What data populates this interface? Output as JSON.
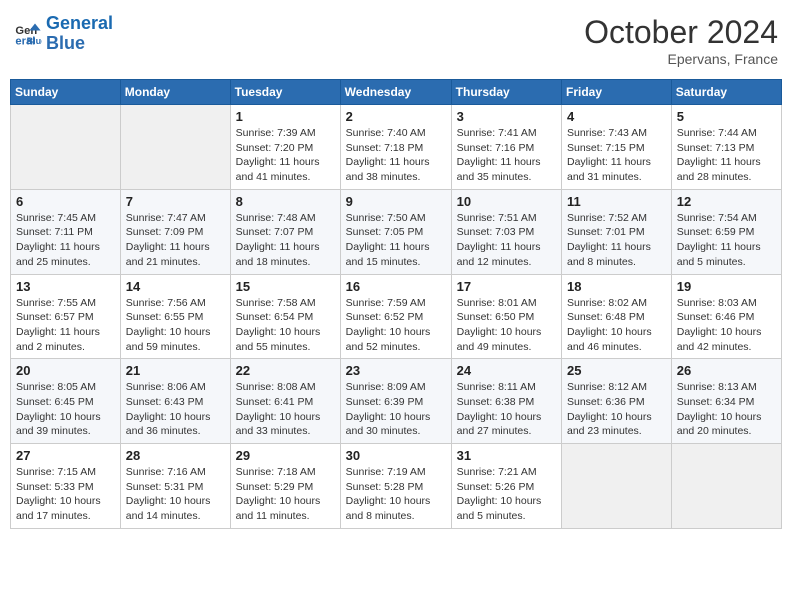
{
  "header": {
    "logo_line1": "General",
    "logo_line2": "Blue",
    "month_title": "October 2024",
    "location": "Epervans, France"
  },
  "weekdays": [
    "Sunday",
    "Monday",
    "Tuesday",
    "Wednesday",
    "Thursday",
    "Friday",
    "Saturday"
  ],
  "weeks": [
    [
      {
        "day": "",
        "info": ""
      },
      {
        "day": "",
        "info": ""
      },
      {
        "day": "1",
        "info": "Sunrise: 7:39 AM\nSunset: 7:20 PM\nDaylight: 11 hours and 41 minutes."
      },
      {
        "day": "2",
        "info": "Sunrise: 7:40 AM\nSunset: 7:18 PM\nDaylight: 11 hours and 38 minutes."
      },
      {
        "day": "3",
        "info": "Sunrise: 7:41 AM\nSunset: 7:16 PM\nDaylight: 11 hours and 35 minutes."
      },
      {
        "day": "4",
        "info": "Sunrise: 7:43 AM\nSunset: 7:15 PM\nDaylight: 11 hours and 31 minutes."
      },
      {
        "day": "5",
        "info": "Sunrise: 7:44 AM\nSunset: 7:13 PM\nDaylight: 11 hours and 28 minutes."
      }
    ],
    [
      {
        "day": "6",
        "info": "Sunrise: 7:45 AM\nSunset: 7:11 PM\nDaylight: 11 hours and 25 minutes."
      },
      {
        "day": "7",
        "info": "Sunrise: 7:47 AM\nSunset: 7:09 PM\nDaylight: 11 hours and 21 minutes."
      },
      {
        "day": "8",
        "info": "Sunrise: 7:48 AM\nSunset: 7:07 PM\nDaylight: 11 hours and 18 minutes."
      },
      {
        "day": "9",
        "info": "Sunrise: 7:50 AM\nSunset: 7:05 PM\nDaylight: 11 hours and 15 minutes."
      },
      {
        "day": "10",
        "info": "Sunrise: 7:51 AM\nSunset: 7:03 PM\nDaylight: 11 hours and 12 minutes."
      },
      {
        "day": "11",
        "info": "Sunrise: 7:52 AM\nSunset: 7:01 PM\nDaylight: 11 hours and 8 minutes."
      },
      {
        "day": "12",
        "info": "Sunrise: 7:54 AM\nSunset: 6:59 PM\nDaylight: 11 hours and 5 minutes."
      }
    ],
    [
      {
        "day": "13",
        "info": "Sunrise: 7:55 AM\nSunset: 6:57 PM\nDaylight: 11 hours and 2 minutes."
      },
      {
        "day": "14",
        "info": "Sunrise: 7:56 AM\nSunset: 6:55 PM\nDaylight: 10 hours and 59 minutes."
      },
      {
        "day": "15",
        "info": "Sunrise: 7:58 AM\nSunset: 6:54 PM\nDaylight: 10 hours and 55 minutes."
      },
      {
        "day": "16",
        "info": "Sunrise: 7:59 AM\nSunset: 6:52 PM\nDaylight: 10 hours and 52 minutes."
      },
      {
        "day": "17",
        "info": "Sunrise: 8:01 AM\nSunset: 6:50 PM\nDaylight: 10 hours and 49 minutes."
      },
      {
        "day": "18",
        "info": "Sunrise: 8:02 AM\nSunset: 6:48 PM\nDaylight: 10 hours and 46 minutes."
      },
      {
        "day": "19",
        "info": "Sunrise: 8:03 AM\nSunset: 6:46 PM\nDaylight: 10 hours and 42 minutes."
      }
    ],
    [
      {
        "day": "20",
        "info": "Sunrise: 8:05 AM\nSunset: 6:45 PM\nDaylight: 10 hours and 39 minutes."
      },
      {
        "day": "21",
        "info": "Sunrise: 8:06 AM\nSunset: 6:43 PM\nDaylight: 10 hours and 36 minutes."
      },
      {
        "day": "22",
        "info": "Sunrise: 8:08 AM\nSunset: 6:41 PM\nDaylight: 10 hours and 33 minutes."
      },
      {
        "day": "23",
        "info": "Sunrise: 8:09 AM\nSunset: 6:39 PM\nDaylight: 10 hours and 30 minutes."
      },
      {
        "day": "24",
        "info": "Sunrise: 8:11 AM\nSunset: 6:38 PM\nDaylight: 10 hours and 27 minutes."
      },
      {
        "day": "25",
        "info": "Sunrise: 8:12 AM\nSunset: 6:36 PM\nDaylight: 10 hours and 23 minutes."
      },
      {
        "day": "26",
        "info": "Sunrise: 8:13 AM\nSunset: 6:34 PM\nDaylight: 10 hours and 20 minutes."
      }
    ],
    [
      {
        "day": "27",
        "info": "Sunrise: 7:15 AM\nSunset: 5:33 PM\nDaylight: 10 hours and 17 minutes."
      },
      {
        "day": "28",
        "info": "Sunrise: 7:16 AM\nSunset: 5:31 PM\nDaylight: 10 hours and 14 minutes."
      },
      {
        "day": "29",
        "info": "Sunrise: 7:18 AM\nSunset: 5:29 PM\nDaylight: 10 hours and 11 minutes."
      },
      {
        "day": "30",
        "info": "Sunrise: 7:19 AM\nSunset: 5:28 PM\nDaylight: 10 hours and 8 minutes."
      },
      {
        "day": "31",
        "info": "Sunrise: 7:21 AM\nSunset: 5:26 PM\nDaylight: 10 hours and 5 minutes."
      },
      {
        "day": "",
        "info": ""
      },
      {
        "day": "",
        "info": ""
      }
    ]
  ]
}
